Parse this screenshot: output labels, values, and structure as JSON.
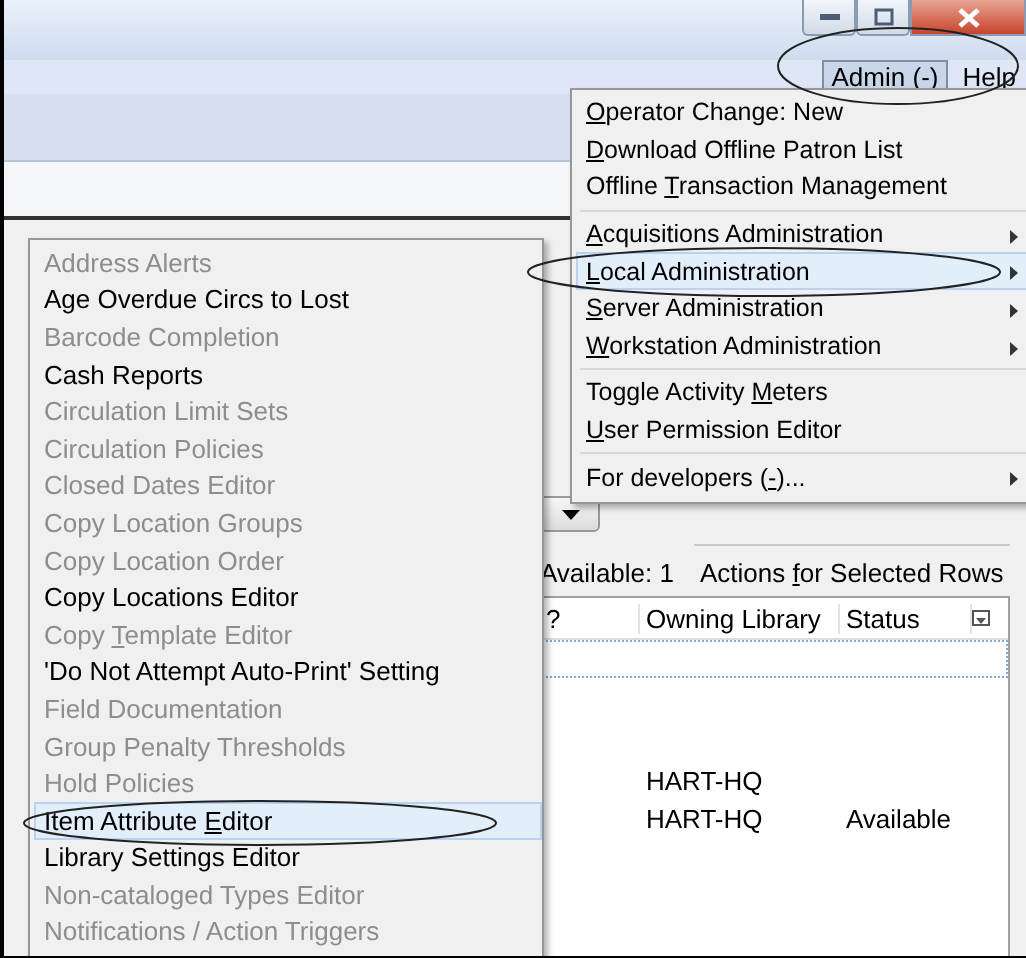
{
  "menubar": {
    "items": [
      {
        "label": {
          "before": "Admin (",
          "key": "-",
          "after": ")"
        },
        "selected": true
      },
      {
        "label": {
          "key": "H",
          "after": "elp"
        },
        "selected": false
      }
    ]
  },
  "admin_menu": {
    "items": [
      {
        "kind": "item",
        "label": {
          "key": "O",
          "after": "perator Change: New"
        },
        "submenu": false,
        "selected": false
      },
      {
        "kind": "item",
        "label": {
          "key": "D",
          "after": "ownload Offline Patron List"
        },
        "submenu": false,
        "selected": false
      },
      {
        "kind": "item",
        "label": {
          "before": "Offline ",
          "key": "T",
          "after": "ransaction Management"
        },
        "submenu": false,
        "selected": false
      },
      {
        "kind": "separator"
      },
      {
        "kind": "item",
        "label": {
          "key": "A",
          "after": "cquisitions Administration"
        },
        "submenu": true,
        "selected": false
      },
      {
        "kind": "item",
        "label": {
          "key": "L",
          "after": "ocal Administration"
        },
        "submenu": true,
        "selected": true
      },
      {
        "kind": "item",
        "label": {
          "key": "S",
          "after": "erver Administration"
        },
        "submenu": true,
        "selected": false
      },
      {
        "kind": "item",
        "label": {
          "key": "W",
          "after": "orkstation Administration"
        },
        "submenu": true,
        "selected": false
      },
      {
        "kind": "separator"
      },
      {
        "kind": "item",
        "label": {
          "before": "Toggle Activity ",
          "key": "M",
          "after": "eters"
        },
        "submenu": false,
        "selected": false
      },
      {
        "kind": "item",
        "label": {
          "key": "U",
          "after": "ser Permission Editor"
        },
        "submenu": false,
        "selected": false
      },
      {
        "kind": "separator"
      },
      {
        "kind": "item",
        "label": {
          "before": "For developers (",
          "key": "-",
          "after": ")..."
        },
        "submenu": true,
        "selected": false
      }
    ]
  },
  "local_admin_menu": {
    "items": [
      {
        "label": {
          "before": "Address Alerts"
        },
        "disabled": true,
        "selected": false
      },
      {
        "label": {
          "before": "Age Overdue Circs to Lost"
        },
        "disabled": false,
        "selected": false
      },
      {
        "label": {
          "before": "Barcode Completion"
        },
        "disabled": true,
        "selected": false
      },
      {
        "label": {
          "before": "Cash Reports"
        },
        "disabled": false,
        "selected": false
      },
      {
        "label": {
          "before": "Circulation Limit Sets"
        },
        "disabled": true,
        "selected": false
      },
      {
        "label": {
          "before": "Circulation Policies"
        },
        "disabled": true,
        "selected": false
      },
      {
        "label": {
          "before": "Closed Dates Editor"
        },
        "disabled": true,
        "selected": false
      },
      {
        "label": {
          "before": "Copy Location Groups"
        },
        "disabled": true,
        "selected": false
      },
      {
        "label": {
          "before": "Copy Location Order"
        },
        "disabled": true,
        "selected": false
      },
      {
        "label": {
          "before": "Copy Locations Editor"
        },
        "disabled": false,
        "selected": false
      },
      {
        "label": {
          "before": "Copy ",
          "key": "T",
          "after": "emplate Editor"
        },
        "disabled": true,
        "selected": false
      },
      {
        "label": {
          "before": "'Do Not Attempt Auto-Print' Setting"
        },
        "disabled": false,
        "selected": false
      },
      {
        "label": {
          "before": "Field Documentation"
        },
        "disabled": true,
        "selected": false
      },
      {
        "label": {
          "before": "Group Penalty Thresholds"
        },
        "disabled": true,
        "selected": false
      },
      {
        "label": {
          "before": "Hold Policies"
        },
        "disabled": true,
        "selected": false
      },
      {
        "label": {
          "before": "Item Attribute ",
          "key": "E",
          "after": "ditor"
        },
        "disabled": false,
        "selected": true
      },
      {
        "label": {
          "before": "Library Settings Editor"
        },
        "disabled": false,
        "selected": false
      },
      {
        "label": {
          "before": "Non-cataloged Types Editor"
        },
        "disabled": true,
        "selected": false
      },
      {
        "label": {
          "before": "Notifications / Action Triggers"
        },
        "disabled": true,
        "selected": false
      }
    ]
  },
  "content": {
    "available": "Available: 1",
    "actions": {
      "before": "Actions ",
      "key": "f",
      "after": "or Selected Rows"
    },
    "table": {
      "columns": [
        "?",
        "Owning Library",
        "Status"
      ],
      "rows": [
        {
          "cells": [
            null,
            "HART-HQ",
            null
          ]
        },
        {
          "cells": [
            null,
            "HART-HQ",
            "Available"
          ]
        }
      ]
    }
  },
  "annotations": [
    {
      "kind": "admin-button"
    },
    {
      "kind": "local-admin"
    },
    {
      "kind": "item-attribute"
    }
  ]
}
